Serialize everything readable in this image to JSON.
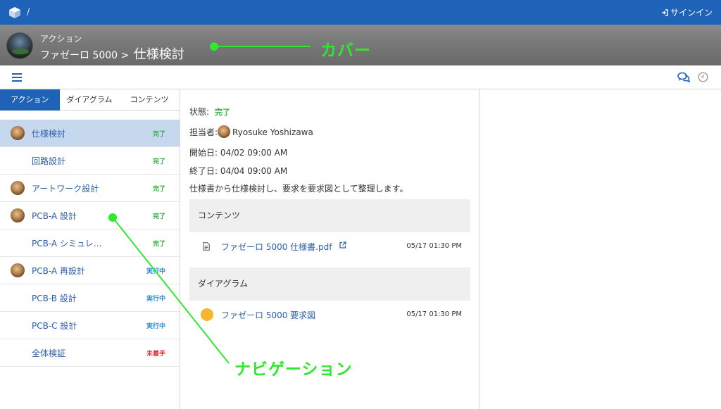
{
  "topbar": {
    "breadcrumb_sep": "/",
    "signin_label": "サインイン",
    "logo_icon": "cube-logo-icon",
    "bg_color": "#1f63b8"
  },
  "cover": {
    "kicker": "アクション",
    "project": "ファゼーロ 5000",
    "separator": ">",
    "current": "仕様検討",
    "annotation_label": "カバー"
  },
  "toolbar": {
    "menu_icon": "hamburger-menu-icon",
    "chat_icon": "chat-bubbles-icon",
    "history_icon": "clock-icon"
  },
  "sidebar": {
    "tabs": [
      {
        "label": "アクション",
        "active": true
      },
      {
        "label": "ダイアグラム",
        "active": false
      },
      {
        "label": "コンテンツ",
        "active": false
      }
    ],
    "items": [
      {
        "label": "仕様検討",
        "status": "完了",
        "status_kind": "done",
        "avatar": true,
        "selected": true
      },
      {
        "label": "回路設計",
        "status": "完了",
        "status_kind": "done",
        "avatar": false,
        "selected": false
      },
      {
        "label": "アートワーク設計",
        "status": "完了",
        "status_kind": "done",
        "avatar": true,
        "selected": false
      },
      {
        "label": "PCB-A 設計",
        "status": "完了",
        "status_kind": "done",
        "avatar": true,
        "selected": false
      },
      {
        "label": "PCB-A シミュレ…",
        "status": "完了",
        "status_kind": "done",
        "avatar": false,
        "selected": false
      },
      {
        "label": "PCB-A 再設計",
        "status": "実行中",
        "status_kind": "running",
        "avatar": true,
        "selected": false
      },
      {
        "label": "PCB-B 設計",
        "status": "実行中",
        "status_kind": "running",
        "avatar": false,
        "selected": false
      },
      {
        "label": "PCB-C 設計",
        "status": "実行中",
        "status_kind": "running",
        "avatar": false,
        "selected": false
      },
      {
        "label": "全体検証",
        "status": "未着手",
        "status_kind": "notstarted",
        "avatar": false,
        "selected": false
      }
    ],
    "annotation_label": "ナビゲーション"
  },
  "detail": {
    "status_label": "状態:",
    "status_value": "完了",
    "assignee_label": "担当者:",
    "assignee_name": "Ryosuke Yoshizawa",
    "start_text": "開始日: 04/02 09:00 AM",
    "end_text": "終了日: 04/04 09:00 AM",
    "description": "仕様書から仕様検討し、要求を要求図として整理します。",
    "contents_header": "コンテンツ",
    "contents": [
      {
        "name": "ファゼーロ 5000 仕様書.pdf",
        "time": "05/17 01:30 PM",
        "icon": "document-icon",
        "external_icon": "external-link-icon"
      }
    ],
    "diagrams_header": "ダイアグラム",
    "diagrams": [
      {
        "name": "ファゼーロ 5000 要求図",
        "time": "05/17 01:30 PM",
        "icon": "yellow-circle-icon"
      }
    ]
  },
  "colors": {
    "accent": "#1f63b8",
    "done": "#3cb04a",
    "running": "#2f8fd8",
    "notstarted": "#e5323a",
    "annotation": "#2fe82f"
  }
}
